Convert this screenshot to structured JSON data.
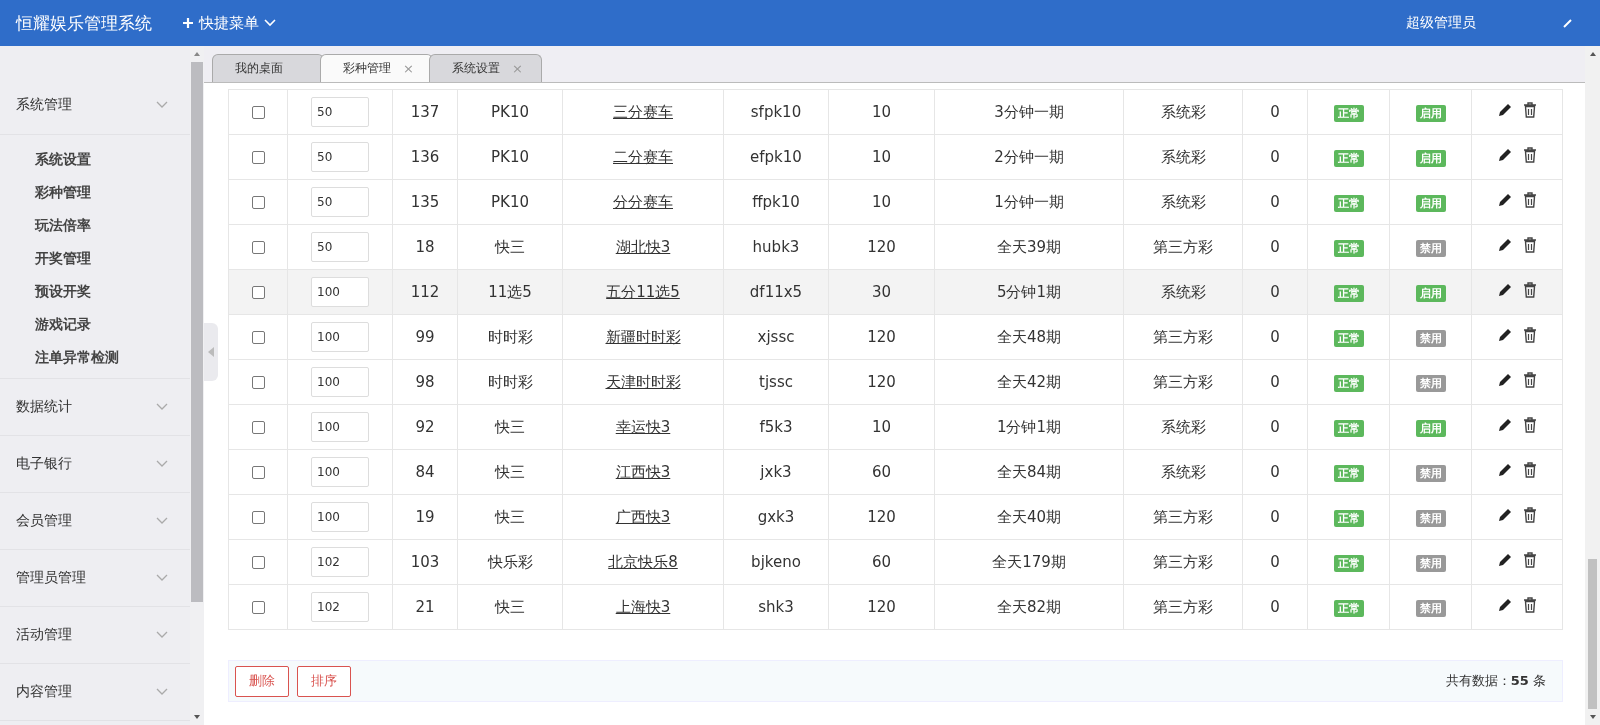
{
  "header": {
    "title": "恒耀娱乐管理系统",
    "quick_menu": "快捷菜单",
    "user": "超级管理员"
  },
  "sidebar": {
    "groups": [
      {
        "label": "系统管理",
        "children": [
          {
            "label": "系统设置"
          },
          {
            "label": "彩种管理"
          },
          {
            "label": "玩法倍率"
          },
          {
            "label": "开奖管理"
          },
          {
            "label": "预设开奖"
          },
          {
            "label": "游戏记录"
          },
          {
            "label": "注单异常检测"
          }
        ]
      },
      {
        "label": "数据统计"
      },
      {
        "label": "电子银行"
      },
      {
        "label": "会员管理"
      },
      {
        "label": "管理员管理"
      },
      {
        "label": "活动管理"
      },
      {
        "label": "内容管理"
      }
    ]
  },
  "tabs": [
    {
      "label": "我的桌面",
      "selected": false
    },
    {
      "label": "彩种管理",
      "selected": true,
      "close": "×"
    },
    {
      "label": "系统设置",
      "selected": false,
      "close": "×"
    }
  ],
  "table": {
    "rows": [
      {
        "checked": false,
        "hovered": false,
        "sort": "50",
        "id": "137",
        "type": "PK10",
        "name": "三分赛车",
        "code": "sfpk10",
        "number": "10",
        "period": "3分钟一期",
        "source": "系统彩",
        "count": "0",
        "status": {
          "label": "正常",
          "ok": true
        },
        "enable": {
          "label": "启用",
          "on": true
        }
      },
      {
        "checked": false,
        "hovered": false,
        "sort": "50",
        "id": "136",
        "type": "PK10",
        "name": "二分赛车",
        "code": "efpk10",
        "number": "10",
        "period": "2分钟一期",
        "source": "系统彩",
        "count": "0",
        "status": {
          "label": "正常",
          "ok": true
        },
        "enable": {
          "label": "启用",
          "on": true
        }
      },
      {
        "checked": false,
        "hovered": false,
        "sort": "50",
        "id": "135",
        "type": "PK10",
        "name": "分分赛车",
        "code": "ffpk10",
        "number": "10",
        "period": "1分钟一期",
        "source": "系统彩",
        "count": "0",
        "status": {
          "label": "正常",
          "ok": true
        },
        "enable": {
          "label": "启用",
          "on": true
        }
      },
      {
        "checked": false,
        "hovered": false,
        "sort": "50",
        "id": "18",
        "type": "快三",
        "name": "湖北快3",
        "code": "hubk3",
        "number": "120",
        "period": "全天39期",
        "source": "第三方彩",
        "count": "0",
        "status": {
          "label": "正常",
          "ok": true
        },
        "enable": {
          "label": "禁用",
          "on": false
        }
      },
      {
        "checked": false,
        "hovered": true,
        "sort": "100",
        "id": "112",
        "type": "11选5",
        "name": "五分11选5",
        "code": "df11x5",
        "number": "30",
        "period": "5分钟1期",
        "source": "系统彩",
        "count": "0",
        "status": {
          "label": "正常",
          "ok": true
        },
        "enable": {
          "label": "启用",
          "on": true
        }
      },
      {
        "checked": false,
        "hovered": false,
        "sort": "100",
        "id": "99",
        "type": "时时彩",
        "name": "新疆时时彩",
        "code": "xjssc",
        "number": "120",
        "period": "全天48期",
        "source": "第三方彩",
        "count": "0",
        "status": {
          "label": "正常",
          "ok": true
        },
        "enable": {
          "label": "禁用",
          "on": false
        }
      },
      {
        "checked": false,
        "hovered": false,
        "sort": "100",
        "id": "98",
        "type": "时时彩",
        "name": "天津时时彩",
        "code": "tjssc",
        "number": "120",
        "period": "全天42期",
        "source": "第三方彩",
        "count": "0",
        "status": {
          "label": "正常",
          "ok": true
        },
        "enable": {
          "label": "禁用",
          "on": false
        }
      },
      {
        "checked": false,
        "hovered": false,
        "sort": "100",
        "id": "92",
        "type": "快三",
        "name": "幸运快3",
        "code": "f5k3",
        "number": "10",
        "period": "1分钟1期",
        "source": "系统彩",
        "count": "0",
        "status": {
          "label": "正常",
          "ok": true
        },
        "enable": {
          "label": "启用",
          "on": true
        }
      },
      {
        "checked": false,
        "hovered": false,
        "sort": "100",
        "id": "84",
        "type": "快三",
        "name": "江西快3",
        "code": "jxk3",
        "number": "60",
        "period": "全天84期",
        "source": "系统彩",
        "count": "0",
        "status": {
          "label": "正常",
          "ok": true
        },
        "enable": {
          "label": "禁用",
          "on": false
        }
      },
      {
        "checked": false,
        "hovered": false,
        "sort": "100",
        "id": "19",
        "type": "快三",
        "name": "广西快3",
        "code": "gxk3",
        "number": "120",
        "period": "全天40期",
        "source": "第三方彩",
        "count": "0",
        "status": {
          "label": "正常",
          "ok": true
        },
        "enable": {
          "label": "禁用",
          "on": false
        }
      },
      {
        "checked": false,
        "hovered": false,
        "sort": "102",
        "id": "103",
        "type": "快乐彩",
        "name": "北京快乐8",
        "code": "bjkeno",
        "number": "60",
        "period": "全天179期",
        "source": "第三方彩",
        "count": "0",
        "status": {
          "label": "正常",
          "ok": true
        },
        "enable": {
          "label": "禁用",
          "on": false
        }
      },
      {
        "checked": false,
        "hovered": false,
        "sort": "102",
        "id": "21",
        "type": "快三",
        "name": "上海快3",
        "code": "shk3",
        "number": "120",
        "period": "全天82期",
        "source": "第三方彩",
        "count": "0",
        "status": {
          "label": "正常",
          "ok": true
        },
        "enable": {
          "label": "禁用",
          "on": false
        }
      }
    ]
  },
  "footer": {
    "buttons": [
      "删除",
      "排序"
    ],
    "total_label": "共有数据：",
    "total": "55",
    "total_unit": "条"
  }
}
